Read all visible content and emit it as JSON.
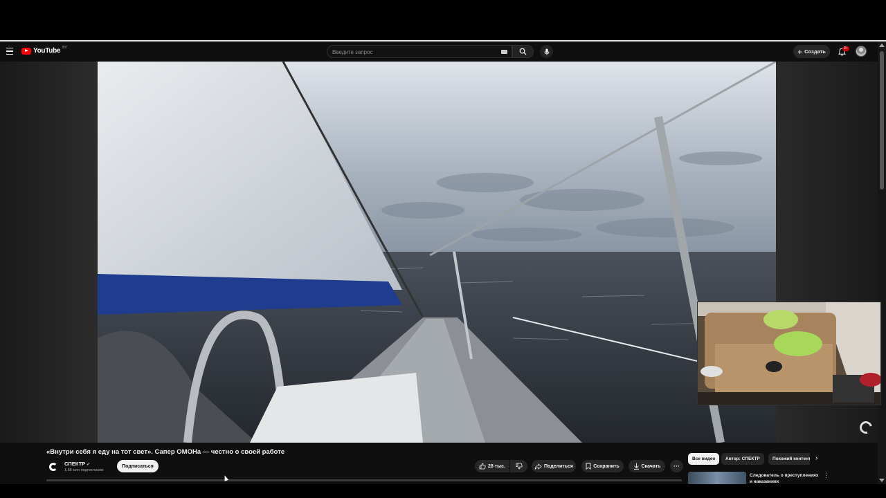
{
  "masthead": {
    "logo_text": "YouTube",
    "logo_country": "BY",
    "search_placeholder": "Введите запрос",
    "create_label": "Создать",
    "notifications_badge": "9+"
  },
  "video": {
    "title": "«Внутри себя я еду на тот свет». Сапер ОМОНа — честно о своей работе"
  },
  "channel": {
    "name": "СПЕКТР",
    "subscribers": "1,58 млн подписчиков",
    "subscribe_label": "Подписаться"
  },
  "actions": {
    "likes": "28 тыс.",
    "share_label": "Поделиться",
    "save_label": "Сохранить",
    "download_label": "Скачать",
    "more_label": "···"
  },
  "chips": [
    "Все видео",
    "Автор: СПЕКТР",
    "Похожий контент"
  ],
  "recommendation": {
    "title": "Следователь о преступлениях",
    "title_line2": "и наказаниях"
  },
  "colors": {
    "brand_red": "#ff0000",
    "badge_red": "#cc0000",
    "background": "#0f0f0f",
    "pill": "#272727"
  },
  "icons": [
    "menu-icon",
    "youtube-logo-icon",
    "keyboard-icon",
    "search-icon",
    "mic-icon",
    "plus-icon",
    "bell-icon",
    "thumb-up-icon",
    "thumb-down-icon",
    "share-icon",
    "bookmark-icon",
    "download-icon",
    "chevron-right-icon",
    "loading-spinner-icon"
  ]
}
